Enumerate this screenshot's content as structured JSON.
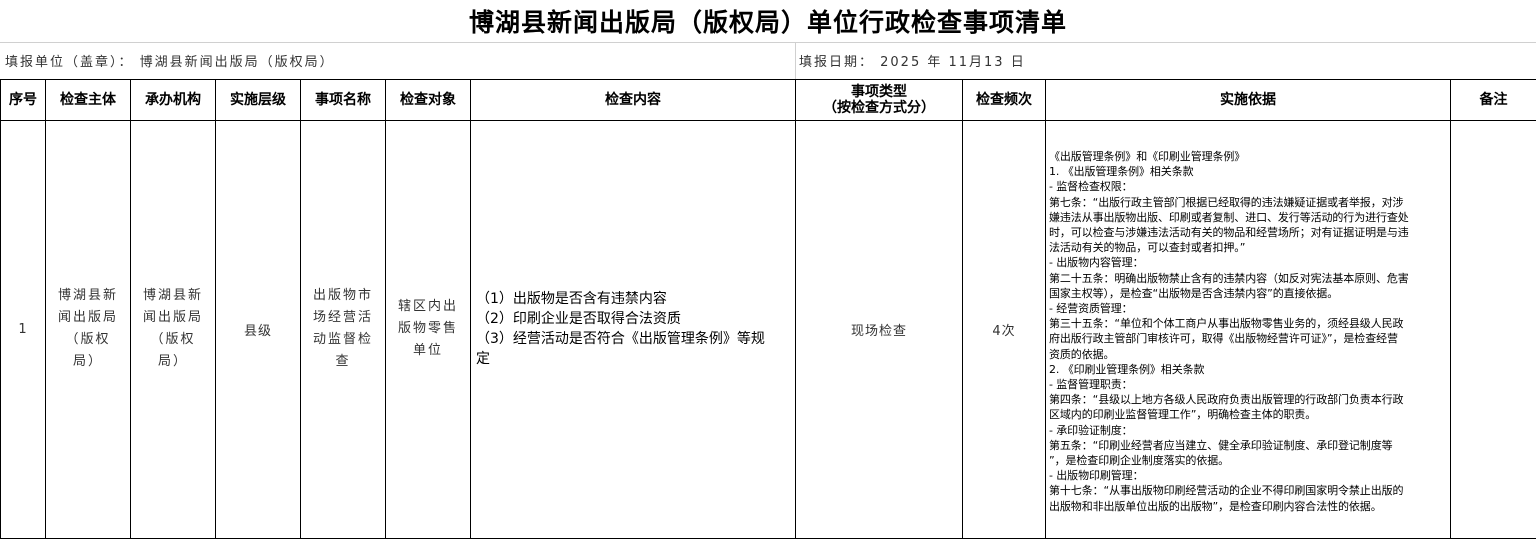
{
  "document": {
    "title": "博湖县新闻出版局（版权局）单位行政检查事项清单",
    "filler_unit": "填报单位（盖章）：  博湖县新闻出版局（版权局）",
    "filler_date": "填报日期：  2025 年 11月13 日"
  },
  "table": {
    "headers": {
      "seq": "序号",
      "subject": "检查主体",
      "agency": "承办机构",
      "level": "实施层级",
      "item": "事项名称",
      "target": "检查对象",
      "content": "检查内容",
      "type_line1": "事项类型",
      "type_line2": "（按检查方式分）",
      "frequency": "检查频次",
      "basis": "实施依据",
      "remarks": "备注"
    },
    "rows": [
      {
        "seq": "1",
        "subject": "博湖县新闻出版局（版权局）",
        "agency": "博湖县新闻出版局（版权局）",
        "level": "县级",
        "item": "出版物市场经营活动监督检查",
        "target": "辖区内出版物零售单位",
        "content": [
          "（1）出版物是否含有违禁内容",
          "（2）印刷企业是否取得合法资质",
          "（3）经营活动是否符合《出版管理条例》等规",
          "定"
        ],
        "type": "现场检查",
        "frequency": "4次",
        "basis": [
          "《出版管理条例》和《印刷业管理条例》",
          "1. 《出版管理条例》相关条款",
          "- 监督检查权限：",
          "第七条：“出版行政主管部门根据已经取得的违法嫌疑证据或者举报，对涉",
          "嫌违法从事出版物出版、印刷或者复制、进口、发行等活动的行为进行查处",
          "时，可以检查与涉嫌违法活动有关的物品和经营场所；对有证据证明是与违",
          "法活动有关的物品，可以查封或者扣押。”",
          "- 出版物内容管理：",
          "第二十五条：明确出版物禁止含有的违禁内容（如反对宪法基本原则、危害",
          "国家主权等），是检查“出版物是否含违禁内容”的直接依据。",
          "- 经营资质管理：",
          "第三十五条：“单位和个体工商户从事出版物零售业务的，须经县级人民政",
          "府出版行政主管部门审核许可，取得《出版物经营许可证》”，是检查经营",
          "资质的依据。",
          "2. 《印刷业管理条例》相关条款",
          "- 监督管理职责：",
          "第四条：“县级以上地方各级人民政府负责出版管理的行政部门负责本行政",
          "区域内的印刷业监督管理工作”，明确检查主体的职责。",
          "- 承印验证制度：",
          "第五条：“印刷业经营者应当建立、健全承印验证制度、承印登记制度等",
          "”，是检查印刷企业制度落实的依据。",
          "- 出版物印刷管理：",
          "第十七条：“从事出版物印刷经营活动的企业不得印刷国家明令禁止出版的",
          "出版物和非出版单位出版的出版物”，是检查印刷内容合法性的依据。"
        ],
        "remarks": ""
      }
    ]
  }
}
